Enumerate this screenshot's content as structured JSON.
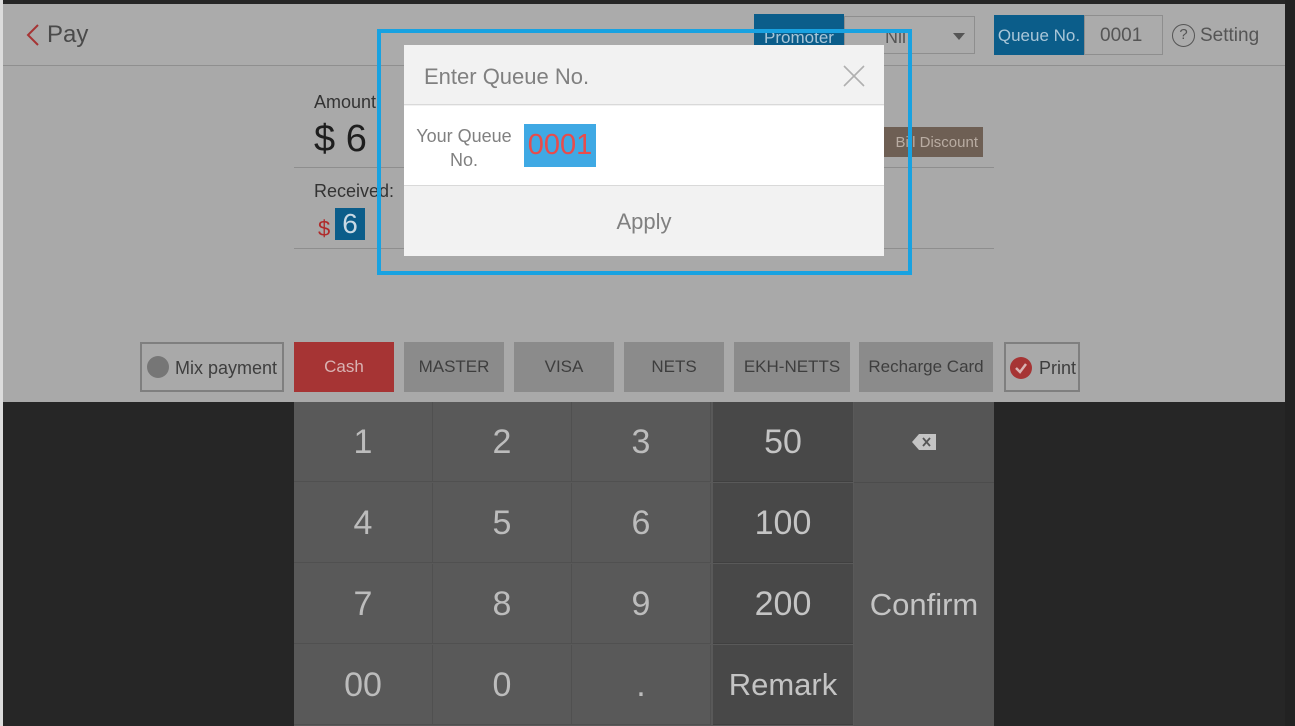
{
  "header": {
    "title": "Pay",
    "promoter_label": "Promoter",
    "promoter_value": "Nil",
    "queue_label": "Queue No.",
    "queue_value": "0001",
    "setting_label": "Setting",
    "setting_icon": "?"
  },
  "payment": {
    "amount_label": "Amount:",
    "amount_value": "$ 6",
    "bill_discount_label": "Bill Discount",
    "received_label": "Received:",
    "received_currency": "$",
    "received_value": "6"
  },
  "methods": {
    "mix_payment": "Mix payment",
    "cash": "Cash",
    "master": "MASTER",
    "visa": "VISA",
    "nets": "NETS",
    "ekh_netts": "EKH-NETTS",
    "recharge_card": "Recharge Card",
    "print": "Print"
  },
  "keypad": {
    "keys": [
      "1",
      "2",
      "3",
      "4",
      "5",
      "6",
      "7",
      "8",
      "9",
      "00",
      "0",
      "."
    ],
    "quick": [
      "50",
      "100",
      "200"
    ],
    "remark": "Remark",
    "confirm": "Confirm"
  },
  "dialog": {
    "title": "Enter Queue No.",
    "field_label": "Your Queue No.",
    "field_value": "0001",
    "apply_label": "Apply"
  },
  "colors": {
    "highlight": "#18a2e1",
    "primary_blue": "#0b5d8a",
    "cash_red": "#a63434"
  }
}
